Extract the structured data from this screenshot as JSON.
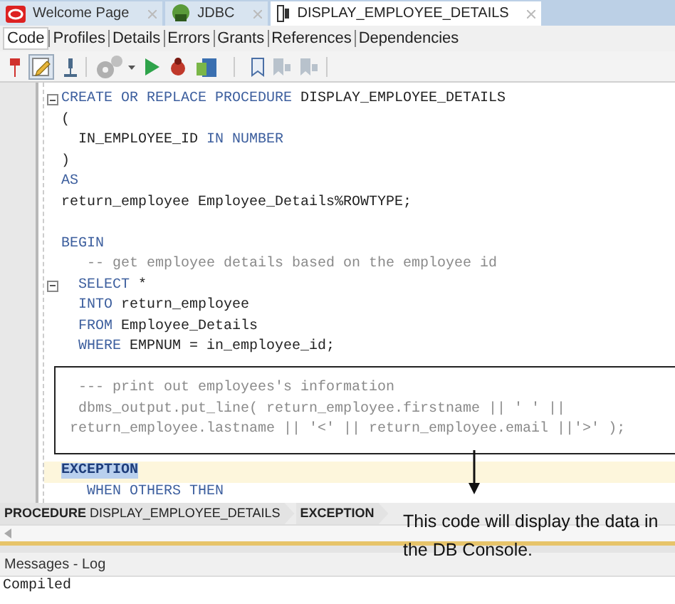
{
  "editor_tabs": [
    {
      "label": "Welcome Page",
      "selected": false
    },
    {
      "label": "JDBC",
      "selected": false
    },
    {
      "label": "DISPLAY_EMPLOYEE_DETAILS",
      "selected": true
    }
  ],
  "view_tabs": [
    {
      "label": "Code",
      "selected": true
    },
    {
      "label": "Profiles",
      "selected": false
    },
    {
      "label": "Details",
      "selected": false
    },
    {
      "label": "Errors",
      "selected": false
    },
    {
      "label": "Grants",
      "selected": false
    },
    {
      "label": "References",
      "selected": false
    },
    {
      "label": "Dependencies",
      "selected": false
    }
  ],
  "code_lines": [
    {
      "kind": "code",
      "fold": true,
      "segments": [
        {
          "text": "CREATE OR REPLACE PROCEDURE",
          "kind": "keyword"
        },
        {
          "text": " DISPLAY_EMPLOYEE_DETAILS",
          "kind": "plain"
        }
      ]
    },
    {
      "kind": "code",
      "segments": [
        {
          "text": "(",
          "kind": "plain"
        }
      ]
    },
    {
      "kind": "code",
      "segments": [
        {
          "text": "  IN_EMPLOYEE_ID ",
          "kind": "plain"
        },
        {
          "text": "IN NUMBER",
          "kind": "keyword"
        }
      ]
    },
    {
      "kind": "code",
      "segments": [
        {
          "text": ")",
          "kind": "plain"
        }
      ]
    },
    {
      "kind": "code",
      "segments": [
        {
          "text": "AS",
          "kind": "keyword"
        }
      ]
    },
    {
      "kind": "code",
      "segments": [
        {
          "text": "return_employee Employee_Details%ROWTYPE;",
          "kind": "plain"
        }
      ]
    },
    {
      "kind": "blank"
    },
    {
      "kind": "code",
      "segments": [
        {
          "text": "BEGIN",
          "kind": "keyword"
        }
      ]
    },
    {
      "kind": "code",
      "segments": [
        {
          "text": "   -- get employee details based on the employee id",
          "kind": "comment"
        }
      ]
    },
    {
      "kind": "code",
      "fold": true,
      "segments": [
        {
          "text": "  SELECT",
          "kind": "keyword"
        },
        {
          "text": " *",
          "kind": "plain"
        }
      ]
    },
    {
      "kind": "code",
      "segments": [
        {
          "text": "  INTO",
          "kind": "keyword"
        },
        {
          "text": " return_employee",
          "kind": "plain"
        }
      ]
    },
    {
      "kind": "code",
      "segments": [
        {
          "text": "  FROM",
          "kind": "keyword"
        },
        {
          "text": " Employee_Details",
          "kind": "plain"
        }
      ]
    },
    {
      "kind": "code",
      "segments": [
        {
          "text": "  WHERE",
          "kind": "keyword"
        },
        {
          "text": " EMPNUM = in_employee_id;",
          "kind": "plain"
        }
      ]
    },
    {
      "kind": "blank"
    },
    {
      "kind": "code",
      "segments": [
        {
          "text": "  --- print out employees's information",
          "kind": "comment"
        }
      ]
    },
    {
      "kind": "code",
      "segments": [
        {
          "text": "  dbms_output.put_line( return_employee.firstname || ' ' ||",
          "kind": "comment"
        }
      ]
    },
    {
      "kind": "code",
      "segments": [
        {
          "text": " return_employee.lastname || '<' || return_employee.email ||'>' );",
          "kind": "comment"
        }
      ]
    },
    {
      "kind": "blank"
    },
    {
      "kind": "code",
      "current": true,
      "segments": [
        {
          "text": "EXCEPTION",
          "kind": "selected"
        }
      ]
    },
    {
      "kind": "code",
      "segments": [
        {
          "text": "   WHEN OTHERS THEN",
          "kind": "keyword"
        }
      ]
    }
  ],
  "breadcrumb": [
    {
      "keyword": "PROCEDURE",
      "name": "DISPLAY_EMPLOYEE_DETAILS"
    },
    {
      "keyword": "EXCEPTION"
    }
  ],
  "annotation": "This code will display the data in the DB Console.",
  "log_panel": {
    "title": "Messages - Log",
    "output": "Compiled"
  }
}
